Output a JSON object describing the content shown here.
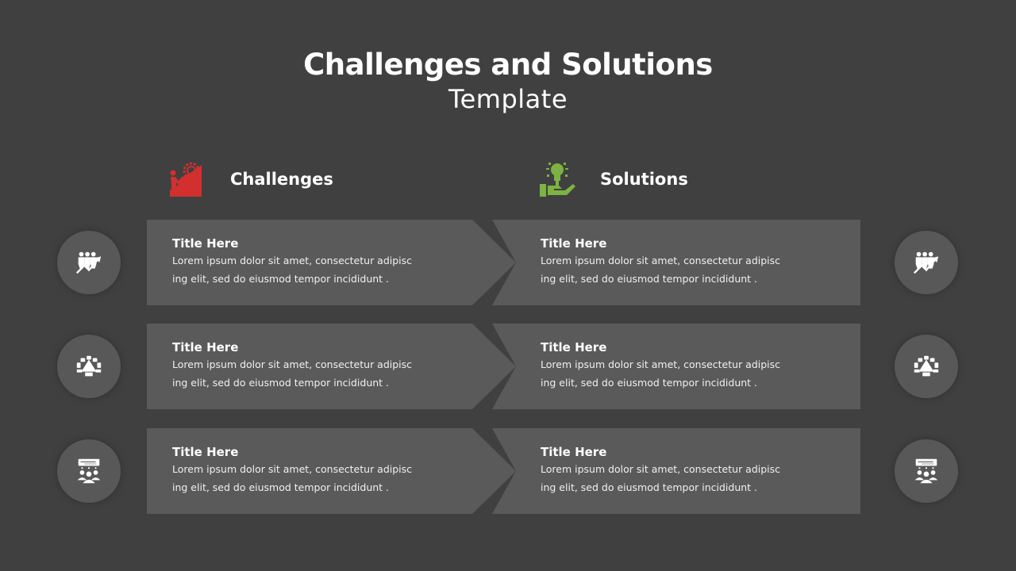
{
  "header": {
    "title": "Challenges and Solutions",
    "subtitle": "Template"
  },
  "columns": {
    "challenges": {
      "label": "Challenges",
      "icon": "climber-gear-icon",
      "color": "#d32f2f"
    },
    "solutions": {
      "label": "Solutions",
      "icon": "lightbulb-hand-icon",
      "color": "#7cb342"
    }
  },
  "rows": [
    {
      "icon": "team-growth-icon",
      "challenge": {
        "title": "Title Here",
        "line1": "Lorem ipsum dolor sit amet, consectetur adipisc",
        "line2": "ing elit, sed do eiusmod tempor incididunt ."
      },
      "solution": {
        "title": "Title Here",
        "line1": "Lorem ipsum dolor sit amet, consectetur adipisc",
        "line2": "ing elit, sed do eiusmod tempor incididunt ."
      }
    },
    {
      "icon": "meeting-table-icon",
      "challenge": {
        "title": "Title Here",
        "line1": "Lorem ipsum dolor sit amet, consectetur adipisc",
        "line2": "ing elit, sed do eiusmod tempor incididunt ."
      },
      "solution": {
        "title": "Title Here",
        "line1": "Lorem ipsum dolor sit amet, consectetur adipisc",
        "line2": "ing elit, sed do eiusmod tempor incididunt ."
      }
    },
    {
      "icon": "presentation-audience-icon",
      "challenge": {
        "title": "Title Here",
        "line1": "Lorem ipsum dolor sit amet, consectetur adipisc",
        "line2": "ing elit, sed do eiusmod tempor incididunt ."
      },
      "solution": {
        "title": "Title Here",
        "line1": "Lorem ipsum dolor sit amet, consectetur adipisc",
        "line2": "ing elit, sed do eiusmod tempor incididunt ."
      }
    }
  ]
}
